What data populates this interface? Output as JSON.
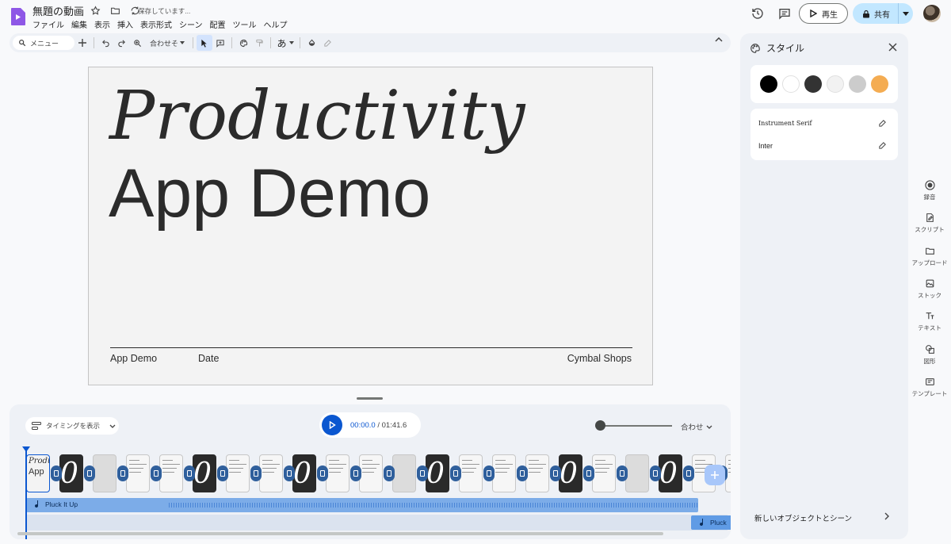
{
  "header": {
    "doc_title": "無題の動画",
    "save_status": "保存しています...",
    "menu": [
      "ファイル",
      "編集",
      "表示",
      "挿入",
      "表示形式",
      "シーン",
      "配置",
      "ツール",
      "ヘルプ"
    ],
    "play_label": "再生",
    "share_label": "共有"
  },
  "toolbar": {
    "menu_search": "メニュー",
    "zoom_label": "合わせそ",
    "text_style": "あ"
  },
  "slide": {
    "title_line1": "Productivity",
    "title_line2": "App Demo",
    "footer_left": "App Demo",
    "footer_mid": "Date",
    "footer_right": "Cymbal Shops"
  },
  "timeline": {
    "timing_label": "タイミングを表示",
    "current_time": "00:00.0",
    "total_time": "01:41.6",
    "time_sep": " / ",
    "fit_label": "合わせ",
    "zoom_level": 0.0,
    "first_thumb_line1": "Produ",
    "first_thumb_line2": "App",
    "audio_main": "Pluck It Up",
    "audio_second": "Pluck"
  },
  "style_panel": {
    "title": "スタイル",
    "colors": [
      "#000000",
      "#ffffff",
      "#333333",
      "#f2f2f2",
      "#cccccc",
      "#f4ac52"
    ],
    "fonts": [
      "Instrument Serif",
      "Inter"
    ],
    "new_objects": "新しいオブジェクトとシーン"
  },
  "side_rail": {
    "items": [
      "録音",
      "スクリプト",
      "アップロード",
      "ストック",
      "テキスト",
      "図形",
      "テンプレート"
    ]
  }
}
